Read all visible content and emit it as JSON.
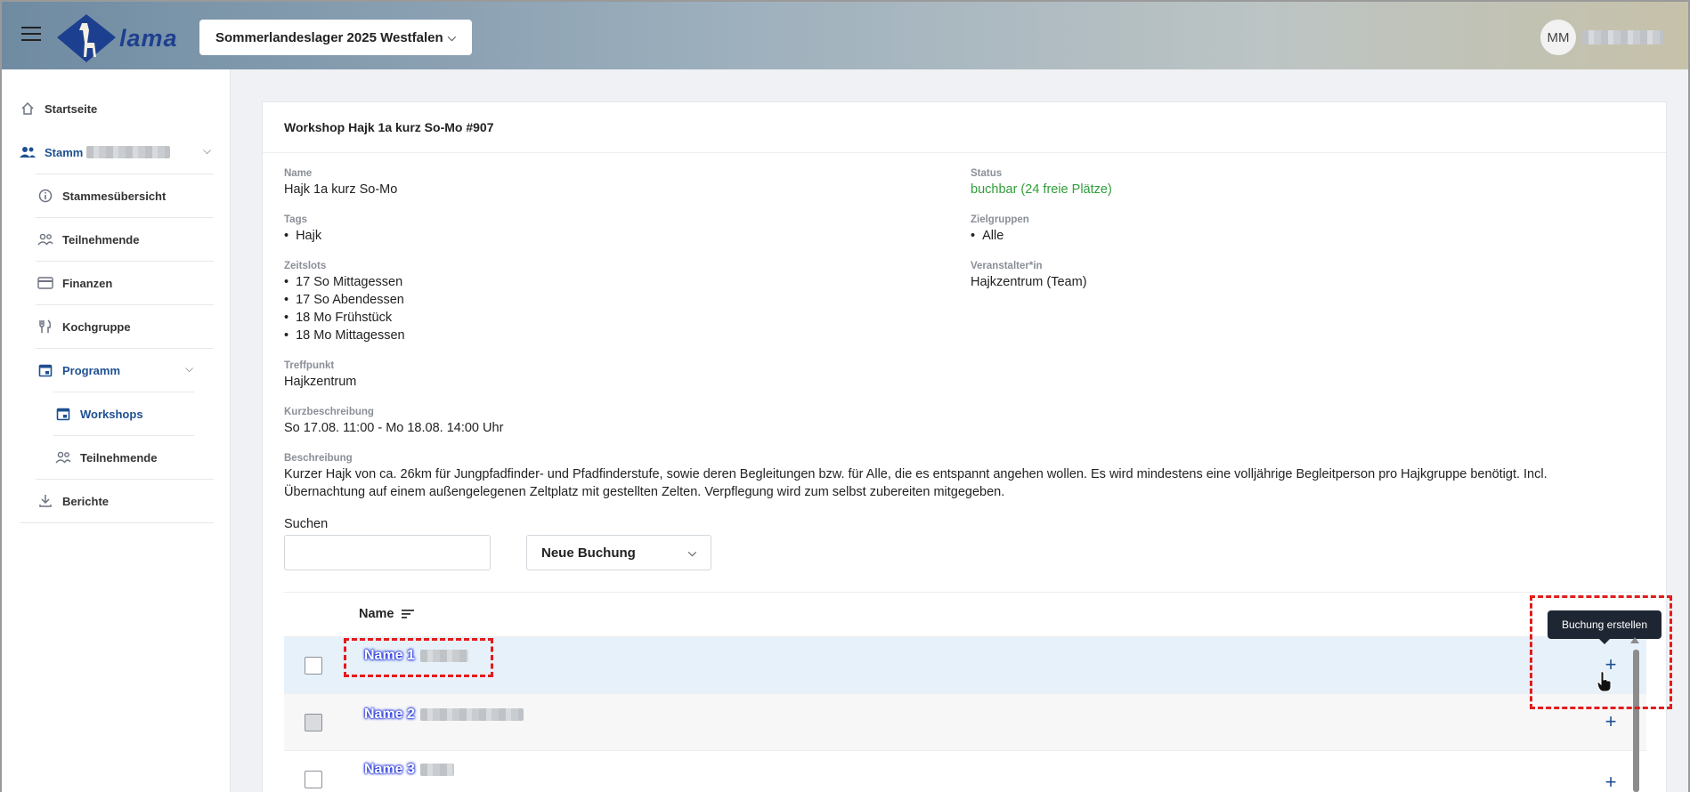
{
  "header": {
    "logo_text": "lama",
    "event_selector": "Sommerlandeslager 2025 Westfalen",
    "avatar_initials": "MM"
  },
  "sidebar": {
    "items": [
      {
        "label": "Startseite",
        "icon": "home-icon"
      },
      {
        "label": "Stamm",
        "icon": "group-icon"
      },
      {
        "label": "Stammesübersicht",
        "icon": "info-icon"
      },
      {
        "label": "Teilnehmende",
        "icon": "people-icon"
      },
      {
        "label": "Finanzen",
        "icon": "credit-card-icon"
      },
      {
        "label": "Kochgruppe",
        "icon": "cutlery-icon"
      },
      {
        "label": "Programm",
        "icon": "calendar-icon"
      },
      {
        "label": "Workshops",
        "icon": "calendar-icon"
      },
      {
        "label": "Teilnehmende",
        "icon": "people-icon"
      },
      {
        "label": "Berichte",
        "icon": "download-icon"
      }
    ]
  },
  "workshop": {
    "title": "Workshop Hajk 1a kurz So-Mo #907",
    "labels": {
      "name": "Name",
      "status": "Status",
      "tags": "Tags",
      "zielgruppen": "Zielgruppen",
      "zeitslots": "Zeitslots",
      "veranstalter": "Veranstalter*in",
      "treffpunkt": "Treffpunkt",
      "kurzbeschreibung": "Kurzbeschreibung",
      "beschreibung": "Beschreibung"
    },
    "name": "Hajk 1a kurz So-Mo",
    "status": "buchbar (24 freie Plätze)",
    "tags": [
      "Hajk"
    ],
    "zielgruppen": [
      "Alle"
    ],
    "zeitslots": [
      "17 So Mittagessen",
      "17 So Abendessen",
      "18 Mo Frühstück",
      "18 Mo Mittagessen"
    ],
    "veranstalter": "Hajkzentrum (Team)",
    "treffpunkt": "Hajkzentrum",
    "kurzbeschreibung": "So 17.08. 11:00 - Mo 18.08. 14:00 Uhr",
    "beschreibung_line1": "Kurzer Hajk von ca. 26km für Jungpfadfinder- und Pfadfinderstufe, sowie deren Begleitungen bzw. für Alle, die es entspannt angehen wollen. Es wird mindestens eine volljährige Begleitperson pro Hajkgruppe benötigt. Incl.",
    "beschreibung_line2": "Übernachtung auf einem außengelegenen Zeltplatz mit gestellten Zelten. Verpflegung wird zum selbst zubereiten mitgegeben."
  },
  "search": {
    "label": "Suchen",
    "placeholder": ""
  },
  "booking_select": {
    "selected": "Neue Buchung"
  },
  "table": {
    "column_name": "Name",
    "rows": [
      {
        "name": "Name 1"
      },
      {
        "name": "Name 2"
      },
      {
        "name": "Name 3"
      }
    ],
    "add_symbol": "+"
  },
  "tooltip": "Buchung erstellen",
  "colors": {
    "status_green": "#2f9e3a",
    "accent": "#1d4f91",
    "highlight": "#e31b1b"
  }
}
